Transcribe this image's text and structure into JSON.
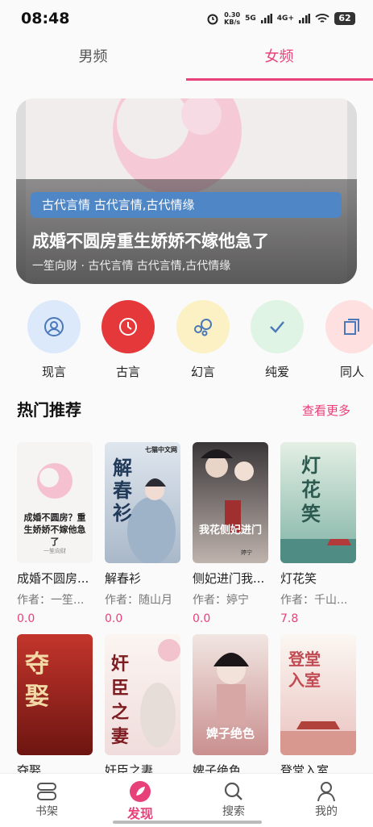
{
  "status_bar": {
    "time": "08:48",
    "speed_value": "0.30",
    "speed_unit": "KB/s",
    "net1": "5G",
    "net2": "4G+",
    "battery": "62"
  },
  "tabs": {
    "male": "男频",
    "female": "女频"
  },
  "banner": {
    "tag": "古代言情 古代言情,古代情缘",
    "title": "成婚不圆房重生娇娇不嫁他急了",
    "subtitle": "一笙向财 · 古代言情 古代言情,古代情缘"
  },
  "categories": [
    {
      "label": "现言",
      "icon": "user-circle-icon",
      "color": "#dbe9fb"
    },
    {
      "label": "古言",
      "icon": "clock-icon",
      "color": "#e5383b"
    },
    {
      "label": "幻言",
      "icon": "bubbles-icon",
      "color": "#fbf1c4"
    },
    {
      "label": "纯爱",
      "icon": "check-icon",
      "color": "#dff4e4"
    },
    {
      "label": "同人",
      "icon": "copy-icon",
      "color": "#fde0df"
    }
  ],
  "section": {
    "title": "热门推荐",
    "more": "查看更多"
  },
  "books": [
    {
      "title": "成婚不圆房...",
      "author": "作者：一笙...",
      "rating": "0.0",
      "cover_text": "成婚不圆房？重生娇娇不嫁他急了",
      "cover_sub": "一笙向财"
    },
    {
      "title": "解春衫",
      "author": "作者：随山月",
      "rating": "0.0",
      "cover_text": "解春衫",
      "cover_sub": "七猫中文网"
    },
    {
      "title": "侧妃进门我...",
      "author": "作者：婷宁",
      "rating": "0.0",
      "cover_text": "我花侧妃进门",
      "cover_sub": "婷宁"
    },
    {
      "title": "灯花笑",
      "author": "作者：千山...",
      "rating": "7.8",
      "cover_text": "灯花笑",
      "cover_sub": ""
    },
    {
      "title": "夺娶",
      "author": "",
      "rating": "",
      "cover_text": "夺娶",
      "cover_sub": ""
    },
    {
      "title": "奸臣之妻",
      "author": "",
      "rating": "",
      "cover_text": "奸臣之妻",
      "cover_sub": ""
    },
    {
      "title": "婢子绝色",
      "author": "",
      "rating": "",
      "cover_text": "婢子绝色",
      "cover_sub": ""
    },
    {
      "title": "登堂入室",
      "author": "",
      "rating": "",
      "cover_text": "登堂入室",
      "cover_sub": ""
    }
  ],
  "bottom_nav": {
    "shelf": "书架",
    "discover": "发现",
    "search": "搜索",
    "mine": "我的"
  },
  "colors": {
    "accent": "#e8417a",
    "tag_blue": "#4f86c6"
  }
}
